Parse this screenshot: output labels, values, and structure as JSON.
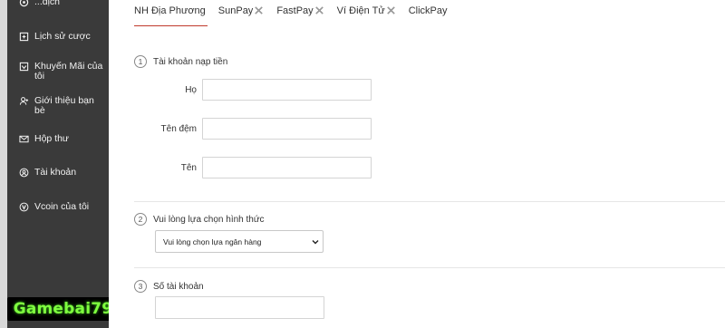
{
  "sidebar": {
    "items": [
      {
        "label": "...dịch",
        "icon": "settings-icon"
      },
      {
        "label": "Lịch sử cược",
        "icon": "history-icon"
      },
      {
        "label": "Khuyến Mãi của tôi",
        "icon": "gift-icon"
      },
      {
        "label": "Giới thiệu bạn bè",
        "icon": "user-plus-icon"
      },
      {
        "label": "Hộp thư",
        "icon": "mail-icon"
      },
      {
        "label": "Tài khoản",
        "icon": "account-icon"
      },
      {
        "label": "Vcoin của tôi",
        "icon": "vcoin-icon"
      }
    ],
    "background": "#3a3a3a"
  },
  "logo": {
    "text": "Gamebai79",
    "color": "#7fff3f"
  },
  "tabs": [
    {
      "label": "NH Địa Phương",
      "active": true,
      "has_x_icon": false
    },
    {
      "label": "SunPay",
      "active": false,
      "has_x_icon": true
    },
    {
      "label": "FastPay",
      "active": false,
      "has_x_icon": true
    },
    {
      "label": "Ví Điện Tử",
      "active": false,
      "has_x_icon": true
    },
    {
      "label": "ClickPay",
      "active": false,
      "has_x_icon": false
    }
  ],
  "accent_color": "#c0392b",
  "sections": {
    "account": {
      "step": "1",
      "title": "Tài khoản nạp tiền",
      "fields": [
        {
          "label": "Họ",
          "value": ""
        },
        {
          "label": "Tên đệm",
          "value": ""
        },
        {
          "label": "Tên",
          "value": ""
        }
      ]
    },
    "method": {
      "step": "2",
      "title": "Vui lòng lựa chọn hình thức",
      "select_value": "Vui lòng chọn lựa ngân hàng"
    },
    "account_number": {
      "step": "3",
      "title": "Số tài khoản",
      "value": ""
    }
  }
}
